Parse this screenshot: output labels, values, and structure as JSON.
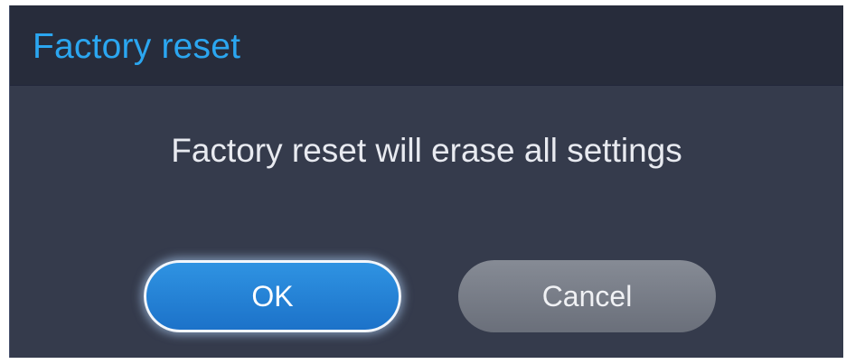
{
  "dialog": {
    "title": "Factory reset",
    "message": "Factory reset will erase all settings",
    "buttons": {
      "ok_label": "OK",
      "cancel_label": "Cancel"
    }
  },
  "colors": {
    "title_text": "#2ba6f0",
    "title_bar_bg": "#272c3b",
    "dialog_bg": "#353b4c",
    "ok_button": "#1c72c9",
    "cancel_button": "#7a7f89"
  }
}
